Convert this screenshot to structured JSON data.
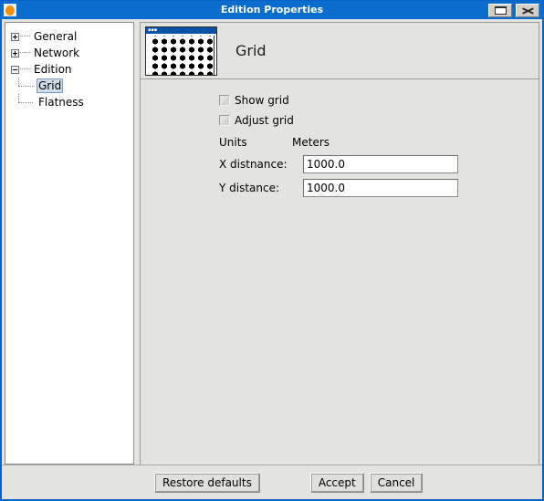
{
  "window": {
    "title": "Edition Properties",
    "icon": "app-icon",
    "controls": [
      {
        "name": "maximize-button",
        "icon": "maximize-icon"
      },
      {
        "name": "close-button",
        "icon": "close-icon"
      }
    ]
  },
  "sidebar": {
    "items": [
      {
        "label": "General",
        "level": 1,
        "toggle": "plus",
        "selected": false
      },
      {
        "label": "Network",
        "level": 1,
        "toggle": "plus",
        "selected": false
      },
      {
        "label": "Edition",
        "level": 1,
        "toggle": "minus",
        "selected": false
      },
      {
        "label": "Grid",
        "level": 2,
        "toggle": "none",
        "selected": true
      },
      {
        "label": "Flatness",
        "level": 2,
        "toggle": "none",
        "selected": false
      }
    ]
  },
  "page": {
    "title": "Grid",
    "preview_icon": "grid-preview-icon",
    "preview_caption": "Grid",
    "checkboxes": [
      {
        "label": "Show grid",
        "checked": false
      },
      {
        "label": "Adjust grid",
        "checked": false
      }
    ],
    "units": {
      "label": "Units",
      "value": "Meters"
    },
    "fields": [
      {
        "label": "X distnance:",
        "value": "1000.0"
      },
      {
        "label": "Y distance:",
        "value": "1000.0"
      }
    ]
  },
  "footer": {
    "restore_label": "Restore defaults",
    "accept_label": "Accept",
    "cancel_label": "Cancel"
  },
  "colors": {
    "titlebar": "#0a6ccc",
    "frame": "#0a62c8",
    "panel": "#e3e3e0",
    "selection": "#cfdcea",
    "accent_orange": "#f39000"
  }
}
